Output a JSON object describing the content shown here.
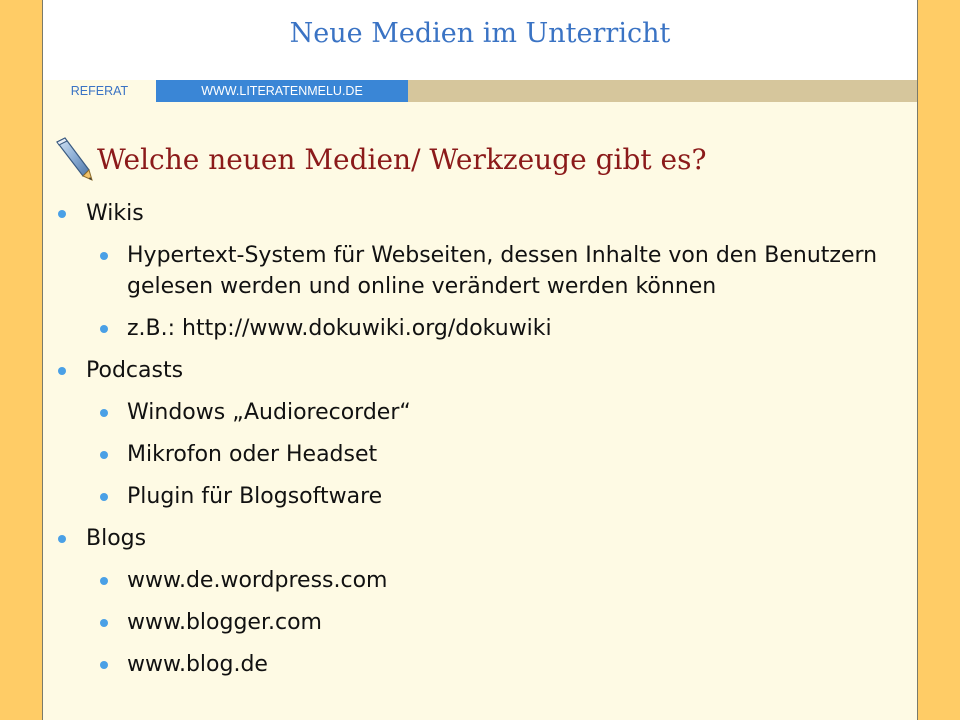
{
  "header": {
    "title": "Neue Medien im Unterricht",
    "nav_tabs": [
      "REFERAT",
      "WWW.LITERATENMELU.DE"
    ]
  },
  "slide": {
    "heading": "Welche neuen Medien/ Werkzeuge gibt es?",
    "heading_icon": "pen-icon",
    "bullets": [
      {
        "label": "Wikis",
        "children": [
          "Hypertext-System für Webseiten, dessen Inhalte von den Benutzern gelesen werden und online verändert werden können",
          "z.B.: http://www.dokuwiki.org/dokuwiki"
        ]
      },
      {
        "label": "Podcasts",
        "children": [
          "Windows „Audiorecorder“",
          "Mikrofon oder Headset",
          "Plugin für Blogsoftware"
        ]
      },
      {
        "label": "Blogs",
        "children": [
          "www.de.wordpress.com",
          "www.blogger.com",
          "www.blog.de"
        ]
      }
    ]
  },
  "colors": {
    "outer_background": "#ffcc66",
    "slide_background": "#fefae4",
    "title": "#3a73c4",
    "heading": "#8b1a1a",
    "bullet": "#4aa0e6",
    "nav_bar": "#d6c69c",
    "nav_active": "#3a86d6"
  }
}
